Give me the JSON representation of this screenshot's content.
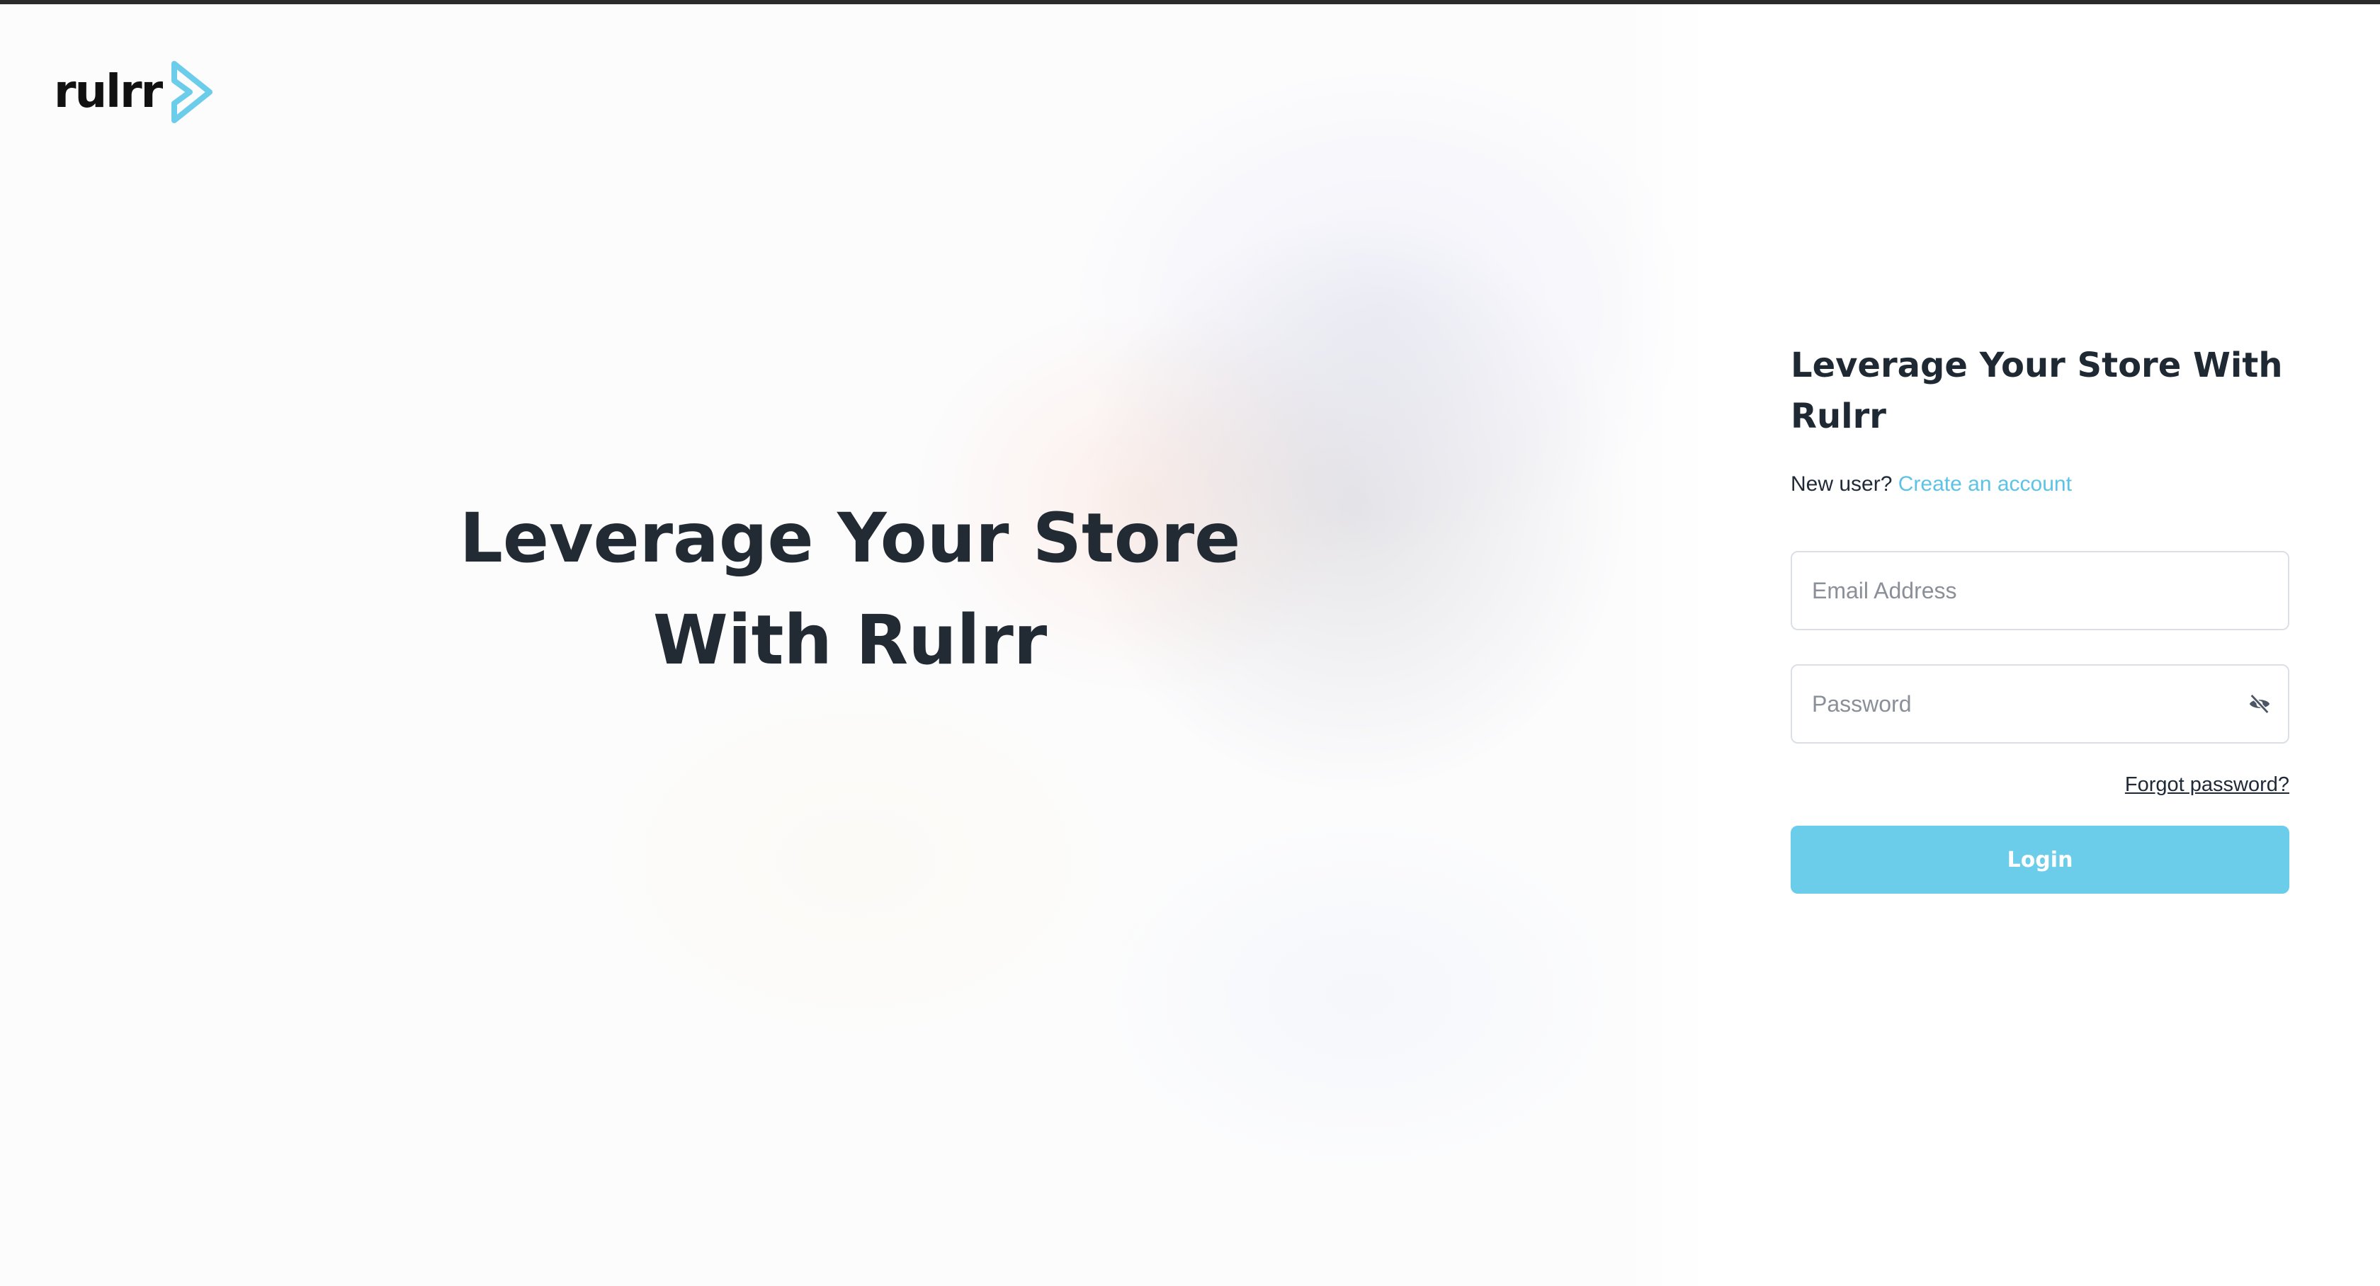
{
  "brand": {
    "logo_text": "rulrr",
    "accent_color": "#6ccdeb",
    "link_color": "#5cc3e6"
  },
  "hero": {
    "heading": "Leverage Your Store With Rulrr"
  },
  "login": {
    "title": "Leverage Your Store With Rulrr",
    "new_user_text": "New user?",
    "create_account_label": "Create an account",
    "email": {
      "placeholder": "Email Address",
      "value": ""
    },
    "password": {
      "placeholder": "Password",
      "value": "",
      "visibility_icon": "eye-off-icon"
    },
    "forgot_password_label": "Forgot password?",
    "login_button_label": "Login"
  }
}
